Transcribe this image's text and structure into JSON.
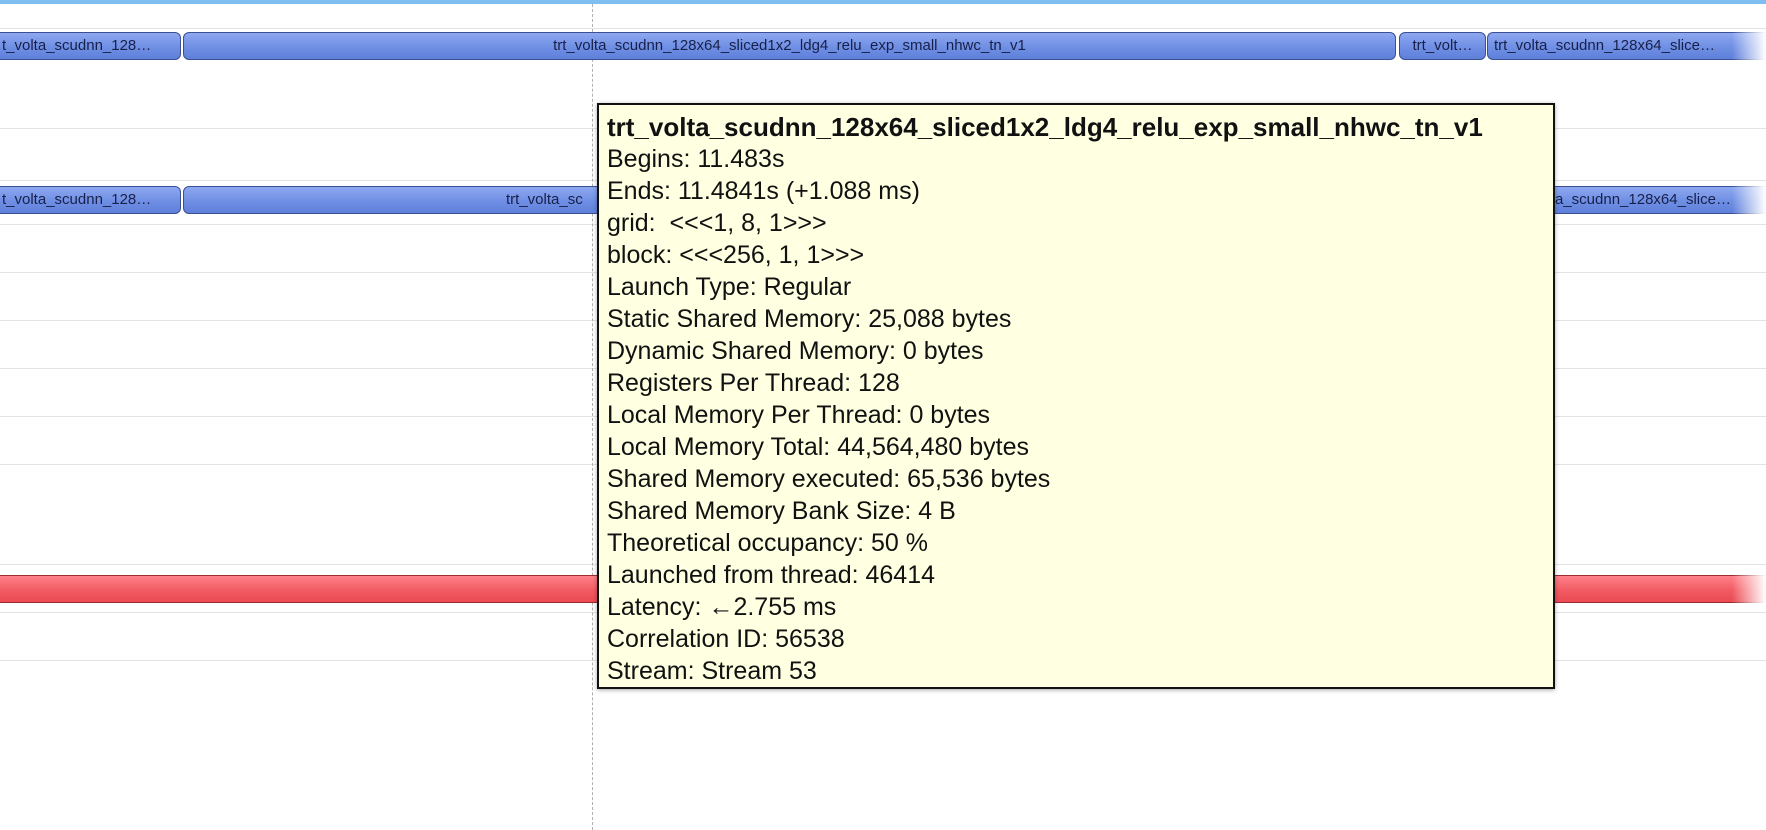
{
  "timeline": {
    "row1": {
      "left_label": "t_volta_scudnn_128…",
      "main_label": "trt_volta_scudnn_128x64_sliced1x2_ldg4_relu_exp_small_nhwc_tn_v1",
      "small_label": "trt_volt…",
      "right_label": "trt_volta_scudnn_128x64_slice…"
    },
    "row2": {
      "left_label": "t_volta_scudnn_128…",
      "main_label": "trt_volta_sc",
      "right_label": "a_scudnn_128x64_slice…"
    },
    "colors": {
      "kernel_fill": "#7090e4",
      "kernel_border": "#3b4f95",
      "red_bar": "#f15b63",
      "top_strip": "#7fbef0"
    }
  },
  "tooltip": {
    "title": "trt_volta_scudnn_128x64_sliced1x2_ldg4_relu_exp_small_nhwc_tn_v1",
    "begins": "Begins: 11.483s",
    "ends": "Ends: 11.4841s (+1.088 ms)",
    "grid": "grid:  <<<1, 8, 1>>>",
    "block": "block: <<<256, 1, 1>>>",
    "launch_type": "Launch Type: Regular",
    "static_shared_memory": "Static Shared Memory: 25,088 bytes",
    "dynamic_shared_memory": "Dynamic Shared Memory: 0 bytes",
    "registers_per_thread": "Registers Per Thread: 128",
    "local_memory_per_thread": "Local Memory Per Thread: 0 bytes",
    "local_memory_total": "Local Memory Total: 44,564,480 bytes",
    "shared_memory_executed": "Shared Memory executed: 65,536 bytes",
    "shared_memory_bank_size": "Shared Memory Bank Size: 4 B",
    "theoretical_occupancy": "Theoretical occupancy: 50 %",
    "launched_from_thread": "Launched from thread: 46414",
    "latency": "Latency: ←2.755 ms",
    "correlation_id": "Correlation ID: 56538",
    "stream": "Stream: Stream 53",
    "background": "#ffffe1"
  }
}
